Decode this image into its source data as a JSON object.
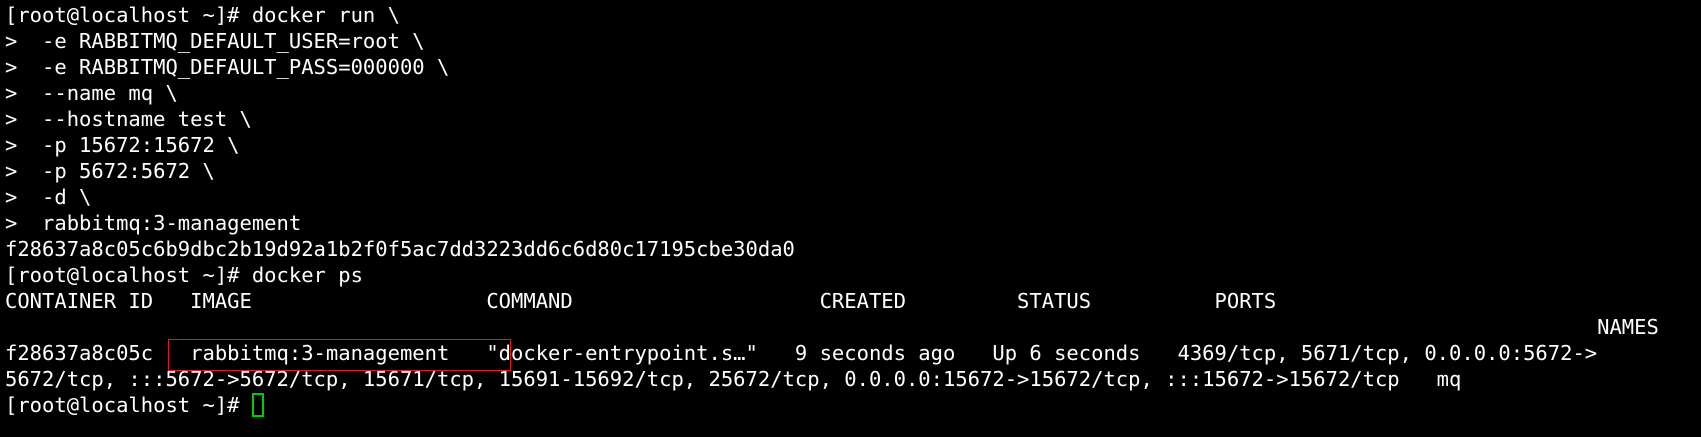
{
  "terminal": {
    "lines": [
      "[root@localhost ~]# docker run \\",
      ">  -e RABBITMQ_DEFAULT_USER=root \\",
      ">  -e RABBITMQ_DEFAULT_PASS=000000 \\",
      ">  --name mq \\",
      ">  --hostname test \\",
      ">  -p 15672:15672 \\",
      ">  -p 5672:5672 \\",
      ">  -d \\",
      ">  rabbitmq:3-management",
      "f28637a8c05c6b9dbc2b19d92a1b2f0f5ac7dd3223dd6c6d80c17195cbe30da0",
      "[root@localhost ~]# docker ps",
      "CONTAINER ID   IMAGE                   COMMAND                    CREATED         STATUS          PORTS",
      "                                                                                                                                 NAMES",
      "f28637a8c05c   rabbitmq:3-management   \"docker-entrypoint.s…\"   9 seconds ago   Up 6 seconds   4369/tcp, 5671/tcp, 0.0.0.0:5672->",
      "5672/tcp, :::5672->5672/tcp, 15671/tcp, 15691-15692/tcp, 25672/tcp, 0.0.0.0:15672->15672/tcp, :::15672->15672/tcp   mq"
    ],
    "prompt": "[root@localhost ~]# ",
    "colors": {
      "background": "#000000",
      "text": "#ffffff",
      "cursor": "#00cc00",
      "highlight": "#d42020"
    }
  }
}
